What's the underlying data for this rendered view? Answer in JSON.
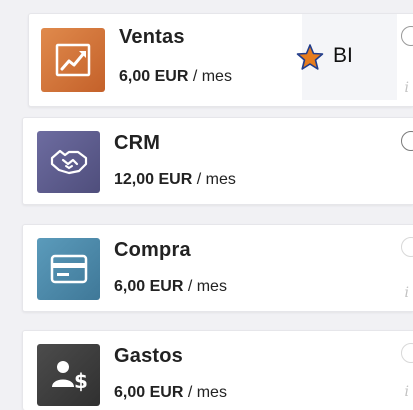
{
  "apps": [
    {
      "name": "Ventas",
      "amount": "6,00 EUR",
      "period": "/ mes",
      "icon": "sales-trend-icon",
      "color": "#d2743b"
    },
    {
      "name": "CRM",
      "amount": "12,00 EUR",
      "period": "/ mes",
      "icon": "handshake-icon",
      "color": "#5d5c8f"
    },
    {
      "name": "Compra",
      "amount": "6,00 EUR",
      "period": "/ mes",
      "icon": "credit-card-icon",
      "color": "#4e8aaa"
    },
    {
      "name": "Gastos",
      "amount": "6,00 EUR",
      "period": "/ mes",
      "icon": "expense-user-dollar-icon",
      "color": "#3f3f3f"
    }
  ],
  "info_glyph": "i",
  "overlay": {
    "star_icon": "star-icon",
    "star_color": "#e57c1f",
    "label": "BI"
  }
}
